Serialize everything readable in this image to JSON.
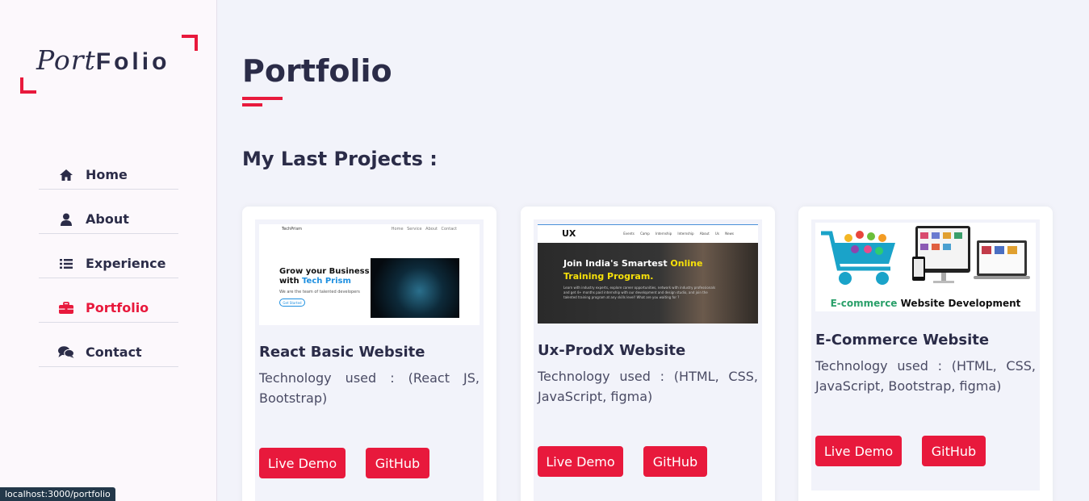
{
  "logo": {
    "part1": "Port",
    "part2": "Folio"
  },
  "nav": [
    {
      "label": "Home",
      "icon": "home-icon",
      "active": false
    },
    {
      "label": "About",
      "icon": "user-icon",
      "active": false
    },
    {
      "label": "Experience",
      "icon": "list-icon",
      "active": false
    },
    {
      "label": "Portfolio",
      "icon": "briefcase-icon",
      "active": true
    },
    {
      "label": "Contact",
      "icon": "comments-icon",
      "active": false
    }
  ],
  "main": {
    "title": "Portfolio",
    "subtitle": "My Last Projects :"
  },
  "projects": [
    {
      "title": "React Basic Website",
      "description": "Technology used : (React JS, Bootstrap)",
      "demo_label": "Live Demo",
      "github_label": "GitHub",
      "thumb": {
        "brand": "TechPrism",
        "links": "Home Service About Contact",
        "heading1": "Grow your Business",
        "heading2a": "with ",
        "heading2b": "Tech Prism",
        "sub": "We are the team of talented developers",
        "button": "Get Started"
      }
    },
    {
      "title": "Ux-ProdX Website",
      "description": "Technology used : (HTML, CSS, JavaScript, figma)",
      "demo_label": "Live Demo",
      "github_label": "GitHub",
      "thumb": {
        "brand": "UX",
        "links": "Events Camp Internship Internship About Us News",
        "heading1": "Join India's Smartest ",
        "heading1b": "Online",
        "heading2": "Training Program.",
        "para": "Learn with industry experts, explore career opportunities, network with industry professionals and get 4+ months paid internship with our development and design studio, and join the talented training program at any skills level! What are you waiting for ?"
      }
    },
    {
      "title": "E-Commerce Website",
      "description": "Technology used : (HTML, CSS, JavaScript, Bootstrap, figma)",
      "demo_label": "Live Demo",
      "github_label": "GitHub",
      "thumb": {
        "caption_a": "E-commerce ",
        "caption_b": "Website Development"
      }
    }
  ],
  "status_bar": "localhost:3000/portfolio",
  "colors": {
    "accent": "#e8193c",
    "text": "#2b2c48",
    "bg": "#f2f3fa",
    "sidebar": "#fcf8fc"
  }
}
